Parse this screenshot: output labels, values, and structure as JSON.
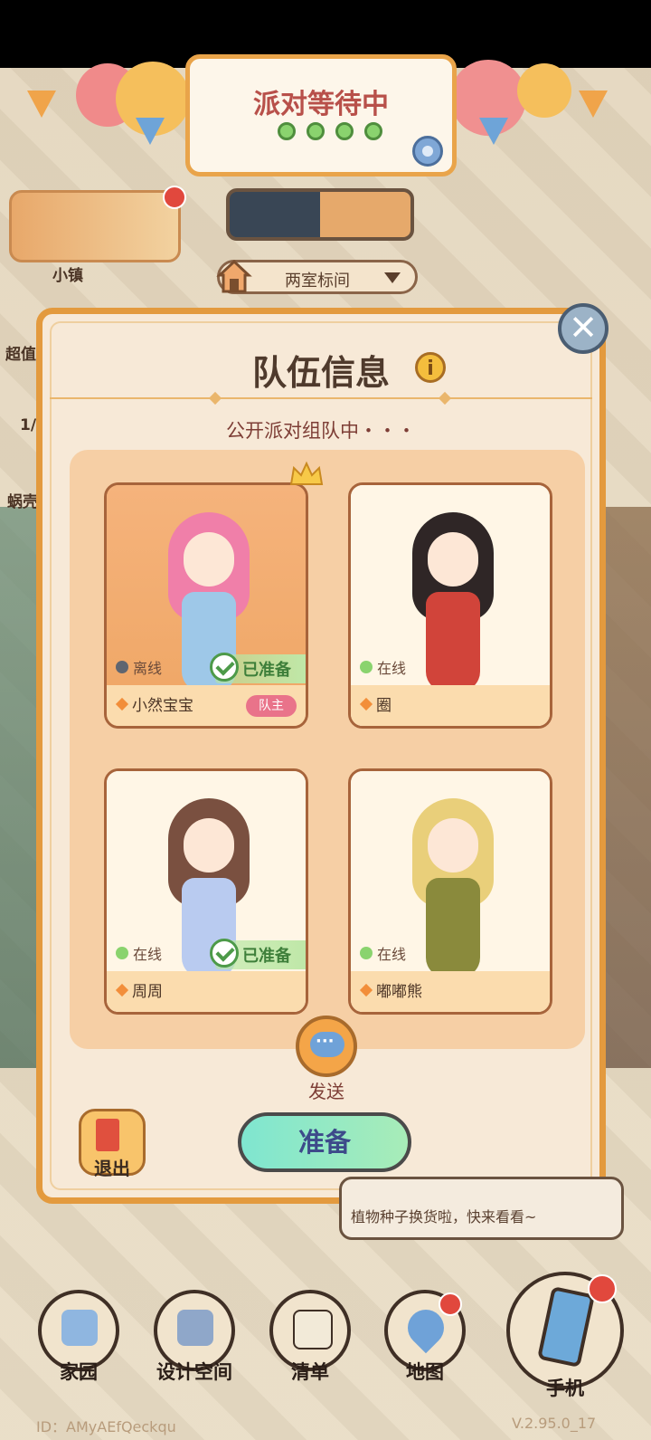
{
  "banner": {
    "title": "派对等待中",
    "dots": 4
  },
  "room": {
    "label": "两室标间"
  },
  "side": {
    "items": [
      "小镇",
      "超值",
      "1/",
      "蜗壳"
    ]
  },
  "modal": {
    "title": "队伍信息",
    "subtitle": "公开派对组队中・・・",
    "members": [
      {
        "name": "小然宝宝",
        "status": "离线",
        "ready": "已准备",
        "badge": "队主"
      },
      {
        "name": "圈",
        "status": "在线"
      },
      {
        "name": "周周",
        "status": "在线",
        "ready": "已准备"
      },
      {
        "name": "嘟嘟熊",
        "status": "在线"
      }
    ],
    "send_label": "发送",
    "exit_label": "退出",
    "ready_button": "准备"
  },
  "speech": {
    "text": "植物种子换货啦，快来看看~"
  },
  "nav": {
    "home": "家园",
    "design": "设计空间",
    "list": "清单",
    "map": "地图",
    "phone": "手机"
  },
  "footer": {
    "id": "ID：AMyAEfQeckqu",
    "version": "V.2.95.0_17"
  },
  "colors": {
    "accent_orange": "#e39a3e",
    "online_green": "#8ad36e",
    "offline_gray": "#5f6570",
    "leader_pink": "#e9738a"
  }
}
